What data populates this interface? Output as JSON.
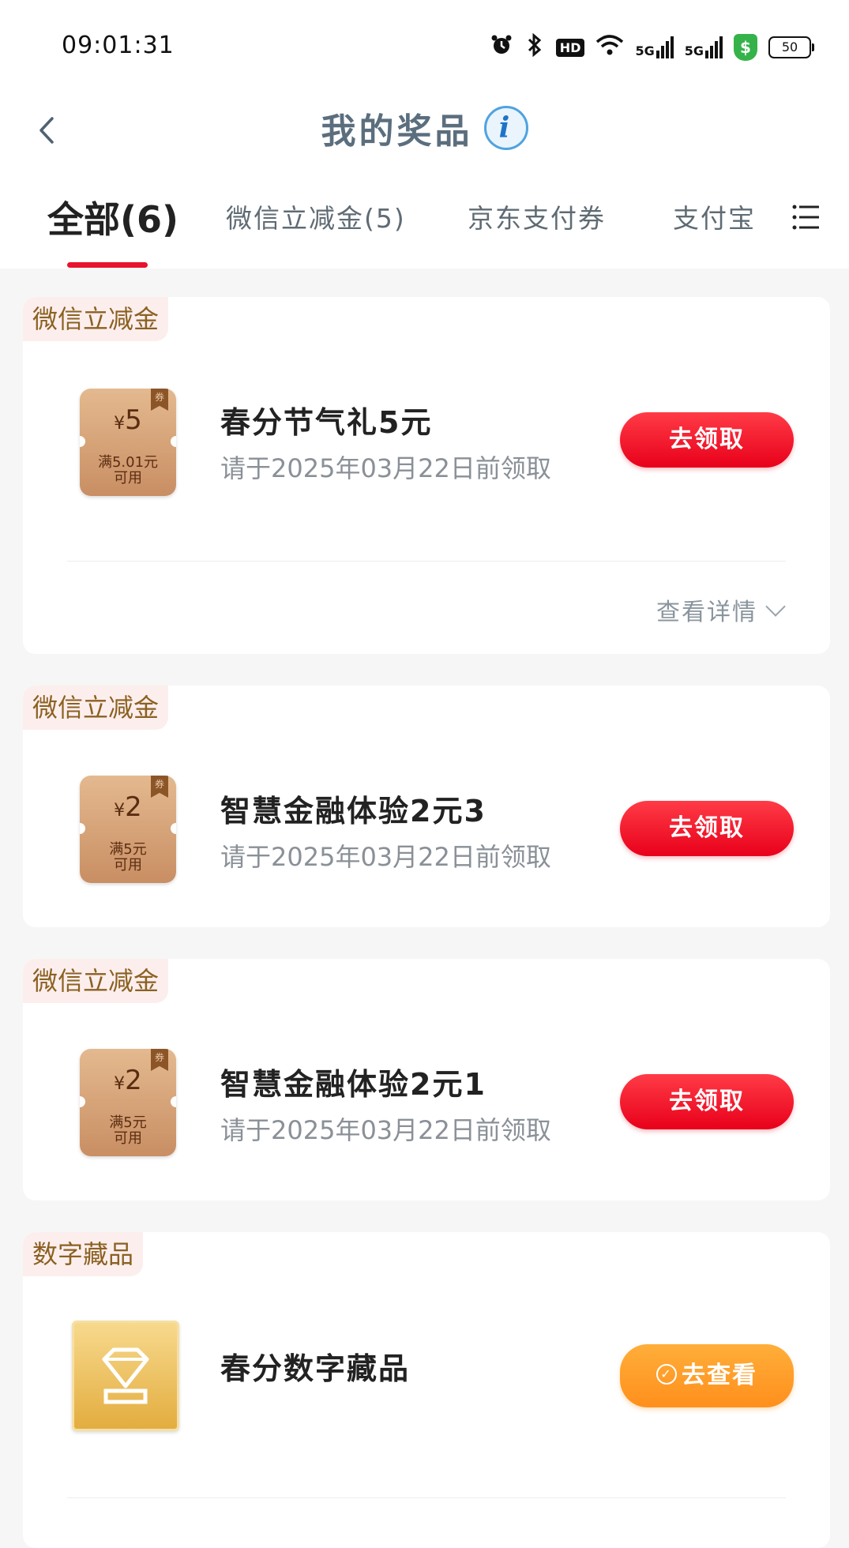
{
  "status_bar": {
    "time": "09:01:31",
    "hd_label": "HD",
    "net_1": "5G",
    "net_2": "5G",
    "shield_symbol": "$",
    "battery": "50"
  },
  "header": {
    "title": "我的奖品",
    "info_symbol": "i"
  },
  "tabs": [
    {
      "label": "全部(6)",
      "active": true
    },
    {
      "label": "微信立减金(5)",
      "active": false
    },
    {
      "label": "京东支付券",
      "active": false
    },
    {
      "label": "支付宝",
      "active": false
    }
  ],
  "colors": {
    "accent_red": "#e8132c",
    "button_orange": "#ff8f1c",
    "tag_bg": "#fdeeee",
    "tag_text": "#8a6121"
  },
  "cards": [
    {
      "tag": "微信立减金",
      "coupon_currency": "¥",
      "coupon_amount": "5",
      "coupon_condition_1": "满5.01元",
      "coupon_condition_2": "可用",
      "ribbon": "券",
      "name": "春分节气礼5元",
      "deadline": "请于2025年03月22日前领取",
      "button": "去领取",
      "details": "查看详情"
    },
    {
      "tag": "微信立减金",
      "coupon_currency": "¥",
      "coupon_amount": "2",
      "coupon_condition_1": "满5元",
      "coupon_condition_2": "可用",
      "ribbon": "券",
      "name": "智慧金融体验2元3",
      "deadline": "请于2025年03月22日前领取",
      "button": "去领取"
    },
    {
      "tag": "微信立减金",
      "coupon_currency": "¥",
      "coupon_amount": "2",
      "coupon_condition_1": "满5元",
      "coupon_condition_2": "可用",
      "ribbon": "券",
      "name": "智慧金融体验2元1",
      "deadline": "请于2025年03月22日前领取",
      "button": "去领取"
    },
    {
      "tag": "数字藏品",
      "name": "春分数字藏品",
      "button": "去查看",
      "button_check": "✓"
    }
  ]
}
